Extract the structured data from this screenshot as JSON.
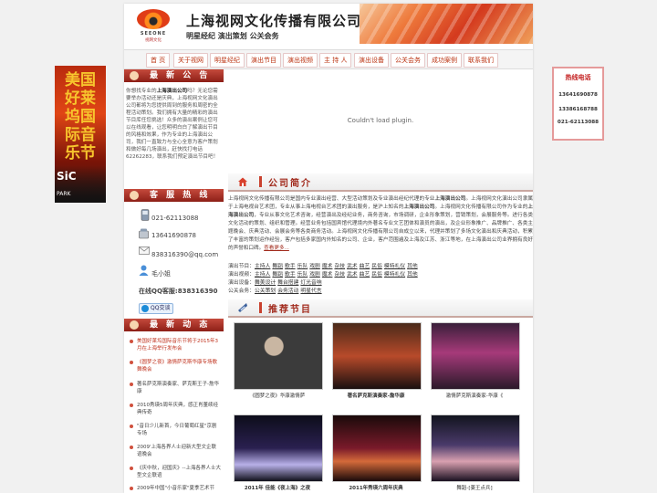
{
  "header": {
    "logo_en": "SEEONE",
    "logo_cn": "视网文化",
    "title": "上海视网文化传播有限公司",
    "subtitle": "明星经纪 演出策划 公关会务"
  },
  "nav": [
    "首 页",
    "关于视网",
    "明星经纪",
    "演出节目",
    "演出视频",
    "主 持 人",
    "演出设备",
    "公关会务",
    "成功案例",
    "联系我们"
  ],
  "left": {
    "notice_title": "最 新 公 告",
    "notice_pre": "你想找专业的",
    "notice_company": "上海演出公司",
    "notice_body": "吗？无论您需要举办活动还是庆典，上海视网文化演出公司都将为您提供周到的服务和周密的全程活动策划。我们拥有大量的精彩的演出节目库任您挑选！众多的演出案例让您可以在线观看，让您明明白白了解演出节目的风格和效果，作为专业的上海演出公司，我们一直致力与全心全意为客户策划和做好每几场演出，赶快找打电话62262283，联系我们预定演出节目吧！",
    "hotline_title": "客 服 热 线",
    "hotline": {
      "tel": "021-62113088",
      "mobile": "13641690878",
      "email": "838316390@qq.com",
      "contact": "毛小姐",
      "qq_text": "在线QQ客服:838316390",
      "qq_button": "QQ交谈"
    },
    "news_title": "最 新 动 态",
    "news": [
      {
        "text": "美国好莱坞国际音乐节将于2015年3月在上海举行发布会",
        "red": true
      },
      {
        "text": "《圆梦之夜》激情萨克斯华康专场歌舞晚会",
        "red": true
      },
      {
        "text": "著名萨克斯演奏家、萨克斯王子-詹华康",
        "red": false
      },
      {
        "text": "2010秀瑛5周年庆典，感正肖董续经典传奇",
        "red": false
      },
      {
        "text": "\"音日少儿新首，今日葡萄红星\"京剧专场",
        "red": false
      },
      {
        "text": "2009'上海各界人士迎新大型文企联谊晚会",
        "red": false
      },
      {
        "text": "《庆中秋，迎国庆》--上海各界人士大型文企联谊",
        "red": false
      },
      {
        "text": "2009年中国\"小音乐家\"夏季艺术节",
        "red": false
      }
    ]
  },
  "main": {
    "plugin_msg": "Couldn't load plugin.",
    "about_title": "公司简介",
    "about_pre": "上海视网文化传播有限公司是国内专业演出经营、大型活动策划及专业演出经纪代理的专业",
    "about_b1": "上海演出公司",
    "about_mid1": "。上海视网文化演出公司隶属于上海电视台艺术团，专业从事上海电视台艺术团的演出服务，是沪上知名的",
    "about_b2": "上海演出公司",
    "about_mid2": "。上海视网文化传播有限公司作为专业的",
    "about_b3": "上海演出公司",
    "about_rest": "，专业从事文化艺术咨询，经营演出及经纪业务，商务咨询，市场调研，企业形象策划，营销策划，会展服务等。进行各类文化活动的策划、组织和管理。经营业务包括国宾馆代理境内外著名专业文艺团体和演员的演出，及企业形象推广、品牌推广、各类主题晚会、庆典活动、会展会务等各类商务活动。上海视网文化传播有限公司自成立以来，代理并策划了多场文化演出和庆典活动，积累了丰富的策划运作经验，客户包括多家国内外知名的公司、企业，客户范围遍及上海及江苏、浙江等地，在上海演出公司业界拥有良好的声誉和口碑。",
    "about_more": "查看更多...",
    "categories": [
      {
        "label": "演出节目：",
        "items": [
          "主持人",
          "舞蹈",
          "歌手",
          "乐队",
          "戏剧",
          "魔术",
          "杂技",
          "武术",
          "曲艺",
          "民俗",
          "模特礼仪",
          "其他"
        ]
      },
      {
        "label": "演出视频：",
        "items": [
          "主持人",
          "舞蹈",
          "歌手",
          "乐队",
          "戏剧",
          "魔术",
          "杂技",
          "武术",
          "曲艺",
          "民俗",
          "模特礼仪",
          "其他"
        ]
      },
      {
        "label": "演出设备：",
        "items": [
          "舞美设计",
          "舞台搭建",
          "灯光音响"
        ]
      },
      {
        "label": "公关会务：",
        "items": [
          "公关策划",
          "会务活动",
          "明星代言"
        ]
      }
    ],
    "recommend_title": "推荐节目",
    "programs": [
      {
        "caption": "《圆梦之夜》华康激情萨"
      },
      {
        "caption": "著名萨克斯演奏家-詹华康"
      },
      {
        "caption": "激情萨克斯演奏家-华康《"
      },
      {
        "caption": "2011年 佳能《夜上海》之夜"
      },
      {
        "caption": "2011年秀瑛六周年庆典"
      },
      {
        "caption": "舞蹈-[姜王点兵]"
      }
    ]
  },
  "side_left": {
    "text": "美国好莱坞国际音乐节",
    "sic": "SiC",
    "park": "PARK"
  },
  "side_right": {
    "title": "热线电话",
    "lines": [
      "13641690878",
      "13386168788",
      "021-62113088"
    ]
  },
  "colors": {
    "brand_red": "#a12a1c",
    "accent_orange": "#ee7a3c"
  }
}
